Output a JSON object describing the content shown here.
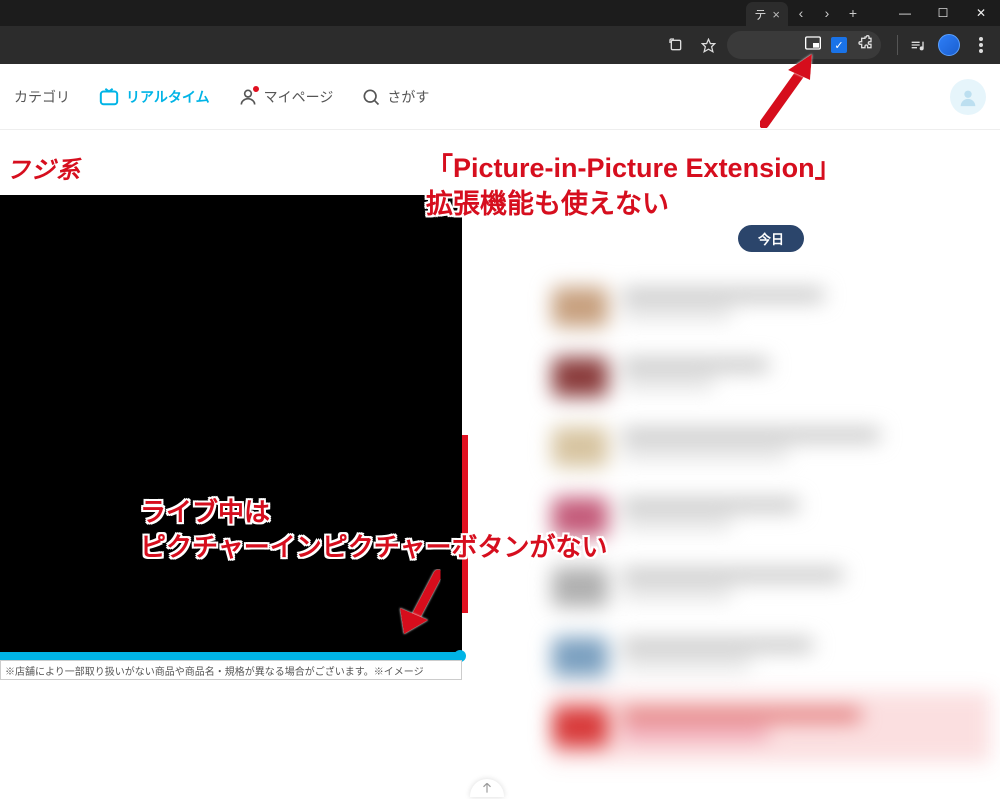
{
  "browser": {
    "tab_label": "テ",
    "tab_close": "×",
    "nav_back": "‹",
    "nav_forward": "›",
    "new_tab": "+",
    "win_min": "—",
    "win_max": "☐",
    "win_close": "✕"
  },
  "site_nav": {
    "category_label": "カテゴリ",
    "realtime_label": "リアルタイム",
    "mypage_label": "マイページ",
    "search_label": "さがす"
  },
  "channel": {
    "label": "フジ系"
  },
  "player": {
    "caption_strip": "※店舗により一部取り扱いがない商品や商品名・規格が異なる場合がございます。※イメージ"
  },
  "schedule": {
    "today_label": "今日"
  },
  "annotations": {
    "top_line1": "「Picture-in-Picture Extension」",
    "top_line2": "拡張機能も使えない",
    "bottom_line1": "ライブ中は",
    "bottom_line2": "ピクチャーインピクチャーボタンがない"
  },
  "colors": {
    "accent_red": "#d60e1e",
    "accent_cyan": "#00b4e6",
    "pill_navy": "#2b456b"
  }
}
